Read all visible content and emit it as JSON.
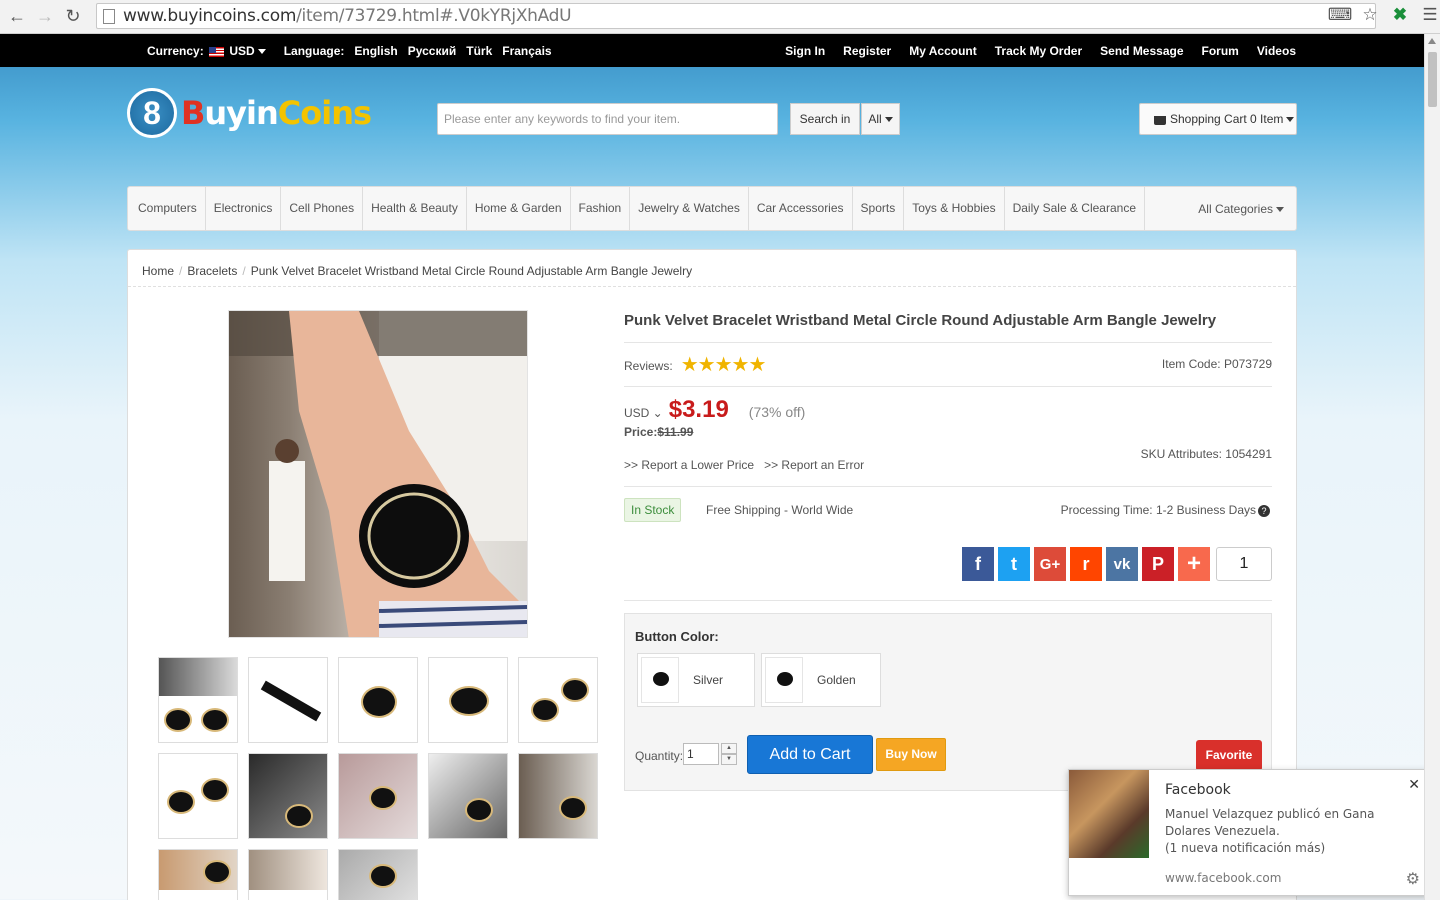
{
  "browser": {
    "url_host": "www.buyincoins.com",
    "url_path": "/item/73729.html#.V0kYRjXhAdU"
  },
  "topbar": {
    "currency_label": "Currency:",
    "currency_value": "USD",
    "language_label": "Language:",
    "languages": [
      "English",
      "Русский",
      "Türk",
      "Français"
    ],
    "links": [
      "Sign In",
      "Register",
      "My Account",
      "Track My Order",
      "Send Message",
      "Forum",
      "Videos"
    ]
  },
  "header": {
    "logo_b": "B",
    "logo_w": "uyin",
    "logo_y": "Coins",
    "logo_mark": "8",
    "search_placeholder": "Please enter any keywords to find your item.",
    "search_button": "Search in",
    "search_scope": "All",
    "cart_label": "Shopping Cart 0 Item"
  },
  "categories": [
    "Computers",
    "Electronics",
    "Cell Phones",
    "Health & Beauty",
    "Home & Garden",
    "Fashion",
    "Jewelry & Watches",
    "Car Accessories",
    "Sports",
    "Toys & Hobbies",
    "Daily Sale & Clearance"
  ],
  "all_categories": "All Categories",
  "breadcrumb": [
    "Home",
    "Bracelets",
    "Punk Velvet Bracelet Wristband Metal Circle Round Adjustable Arm Bangle Jewelry"
  ],
  "product": {
    "title": "Punk Velvet Bracelet Wristband Metal Circle Round Adjustable Arm Bangle Jewelry",
    "reviews_label": "Reviews:",
    "rating": 5,
    "item_code": "Item Code: P073729",
    "currency": "USD",
    "price": "$3.19",
    "discount": "(73% off)",
    "old_price_label": "Price:",
    "old_price": "$11.99",
    "sku": "SKU Attributes: 1054291",
    "report_lower": ">> Report a Lower Price",
    "report_error": ">> Report an Error",
    "stock": "In Stock",
    "shipping": "Free Shipping - World Wide",
    "processing": "Processing Time: 1-2 Business Days",
    "share_count": "1",
    "color_label": "Button Color:",
    "colors": [
      "Silver",
      "Golden"
    ],
    "quantity_label": "Quantity:",
    "quantity": "1",
    "add_to_cart": "Add to Cart",
    "buy_now": "Buy Now",
    "favorite": "Favorite"
  },
  "social": [
    {
      "name": "facebook",
      "glyph": "f",
      "color": "#3b5998"
    },
    {
      "name": "twitter",
      "glyph": "t",
      "color": "#1da1f2"
    },
    {
      "name": "google-plus",
      "glyph": "G+",
      "color": "#dd4b39"
    },
    {
      "name": "reddit",
      "glyph": "r",
      "color": "#ff4500"
    },
    {
      "name": "vk",
      "glyph": "vk",
      "color": "#4c75a3"
    },
    {
      "name": "pinterest",
      "glyph": "P",
      "color": "#cb2027"
    },
    {
      "name": "add-this",
      "glyph": "+",
      "color": "#f8694d"
    }
  ],
  "notification": {
    "title": "Facebook",
    "body": "Manuel Velazquez publicó en Gana Dolares Venezuela.\n(1 nueva notificación más)",
    "source": "www.facebook.com"
  },
  "colors": {
    "price": "#c81b1b",
    "add_to_cart": "#1877d6",
    "buy_now": "#f5a623",
    "favorite": "#d9302b",
    "topbar": "#000000"
  }
}
